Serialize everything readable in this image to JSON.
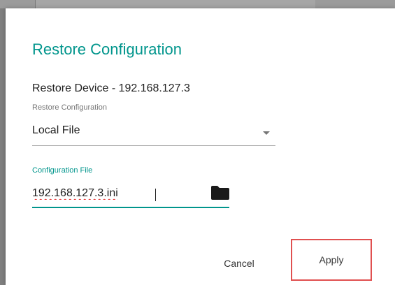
{
  "dialog": {
    "title": "Restore Configuration",
    "device_line": "Restore Device - 192.168.127.3"
  },
  "restore_select": {
    "label": "Restore Configuration",
    "selected": "Local File"
  },
  "config_file": {
    "label": "Configuration File",
    "value": "192.168.127.3.ini"
  },
  "icons": {
    "browse": "folder-icon",
    "dropdown": "chevron-down-icon"
  },
  "actions": {
    "cancel_label": "Cancel",
    "apply_label": "Apply"
  },
  "colors": {
    "accent": "#00958c",
    "highlight": "#e05050"
  }
}
